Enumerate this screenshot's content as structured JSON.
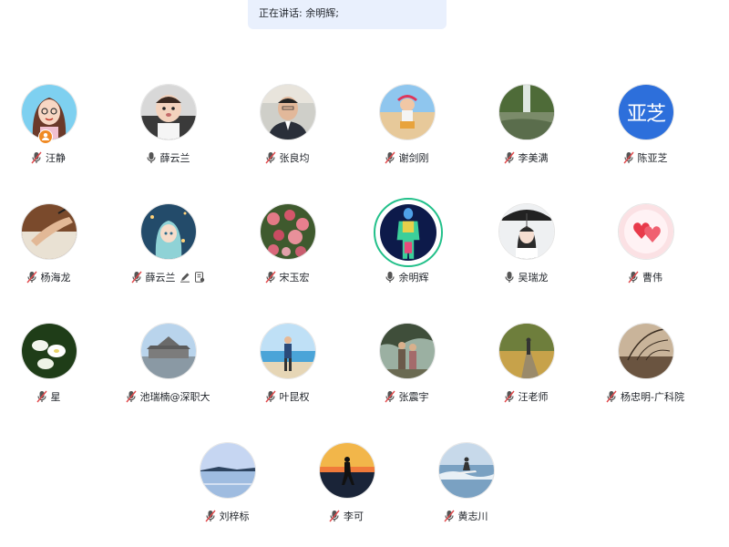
{
  "speaking_banner": {
    "label": "正在讲话: ",
    "speakers": "余明辉;"
  },
  "participants": [
    {
      "name": "汪静",
      "mic": "muted",
      "host": true,
      "avatar": "cartoon-woman"
    },
    {
      "name": "薛云兰",
      "mic": "on",
      "avatar": "baby"
    },
    {
      "name": "张良均",
      "mic": "muted",
      "avatar": "man-suit"
    },
    {
      "name": "谢剑刚",
      "mic": "muted",
      "avatar": "child-beach"
    },
    {
      "name": "李美满",
      "mic": "muted",
      "avatar": "waterfall"
    },
    {
      "name": "陈亚芝",
      "mic": "muted",
      "avatar": "text",
      "avatar_text": "亚芝",
      "avatar_color": "#2d6fdb"
    },
    {
      "name": "杨海龙",
      "mic": "muted",
      "avatar": "hand-writing"
    },
    {
      "name": "薛云兰",
      "mic": "muted",
      "avatar": "anime-girl",
      "extras": [
        "pen-icon",
        "document-icon"
      ]
    },
    {
      "name": "宋玉宏",
      "mic": "muted",
      "avatar": "flowers"
    },
    {
      "name": "余明辉",
      "mic": "on",
      "speaking": true,
      "avatar": "body-scan"
    },
    {
      "name": "吴瑞龙",
      "mic": "on",
      "avatar": "anime-boy-umbrella"
    },
    {
      "name": "曹伟",
      "mic": "muted",
      "avatar": "hearts"
    },
    {
      "name": "星",
      "mic": "muted",
      "avatar": "lotus"
    },
    {
      "name": "池瑞楠@深职大",
      "mic": "muted",
      "avatar": "pavilion"
    },
    {
      "name": "叶昆权",
      "mic": "muted",
      "avatar": "man-beach"
    },
    {
      "name": "张震宇",
      "mic": "muted",
      "avatar": "couple-tree"
    },
    {
      "name": "汪老师",
      "mic": "muted",
      "avatar": "road-sunset"
    },
    {
      "name": "杨忠明-广科院",
      "mic": "muted",
      "avatar": "reeds"
    },
    {
      "name": "刘梓标",
      "mic": "muted",
      "avatar": "lake-sky"
    },
    {
      "name": "李可",
      "mic": "muted",
      "avatar": "silhouette-sunset"
    },
    {
      "name": "黄志川",
      "mic": "muted",
      "avatar": "surfer"
    }
  ],
  "colors": {
    "accent_speaking_ring": "#22c08a",
    "host_badge": "#f08a24",
    "banner_bg": "#e9f0fd",
    "muted_slash": "#e0484b",
    "mic_icon": "#555555"
  }
}
